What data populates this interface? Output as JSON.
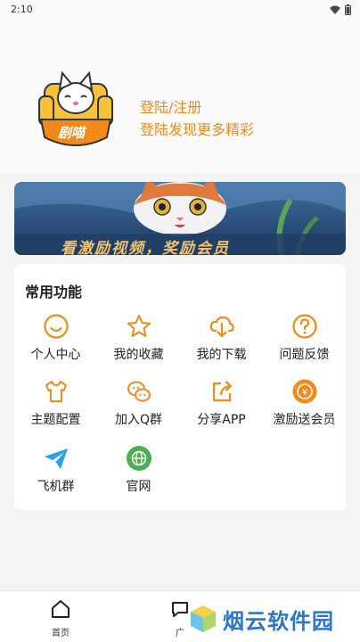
{
  "status_bar": {
    "time": "2:10"
  },
  "header": {
    "logo_text": "剧喵",
    "login_title": "登陆/注册",
    "login_subtitle": "登陆发现更多精彩"
  },
  "banner": {
    "text": "看激励视频，奖励会员"
  },
  "functions": {
    "title": "常用功能",
    "items": [
      {
        "label": "个人中心",
        "icon": "smile-icon"
      },
      {
        "label": "我的收藏",
        "icon": "star-icon"
      },
      {
        "label": "我的下载",
        "icon": "cloud-download-icon"
      },
      {
        "label": "问题反馈",
        "icon": "question-icon"
      },
      {
        "label": "主题配置",
        "icon": "tshirt-icon"
      },
      {
        "label": "加入Q群",
        "icon": "wechat-icon"
      },
      {
        "label": "分享APP",
        "icon": "share-icon"
      },
      {
        "label": "激励送会员",
        "icon": "coin-icon"
      },
      {
        "label": "飞机群",
        "icon": "telegram-icon"
      },
      {
        "label": "官网",
        "icon": "globe-icon"
      }
    ]
  },
  "bottom_nav": [
    {
      "label": "首页",
      "icon": "home-icon"
    },
    {
      "label": "广",
      "icon": "chat-icon"
    }
  ],
  "watermark": {
    "text": "烟云软件园"
  },
  "colors": {
    "accent": "#f08a19",
    "telegram": "#2aa0e6",
    "globe": "#4caf50"
  }
}
